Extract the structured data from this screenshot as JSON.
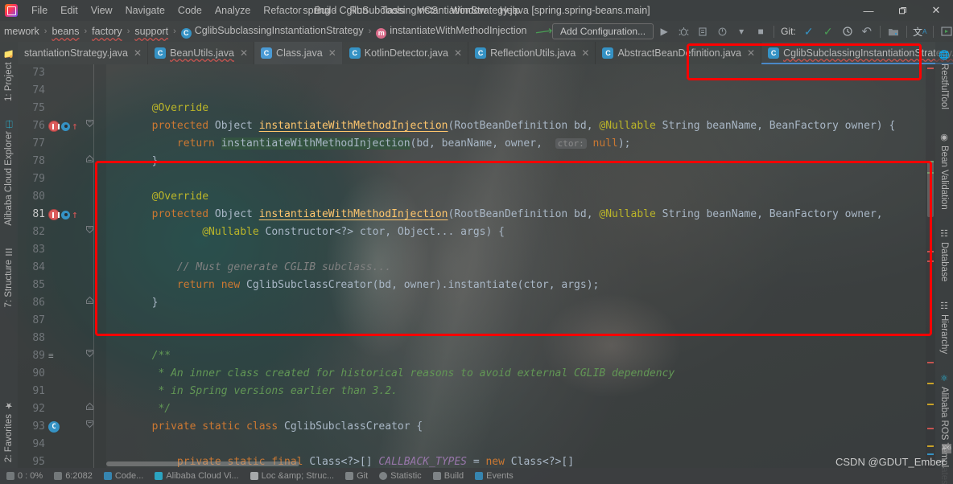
{
  "window": {
    "title": "spring - CglibSubclassingInstantiationStrategy.java [spring.spring-beans.main]",
    "minimize": "—",
    "maximize": "❐",
    "close": "✕"
  },
  "menubar": {
    "items": [
      "File",
      "Edit",
      "View",
      "Navigate",
      "Code",
      "Analyze",
      "Refactor",
      "Build",
      "Run",
      "Tools",
      "VCS",
      "Window",
      "Help"
    ]
  },
  "breadcrumbs": {
    "items": [
      {
        "label": "mework",
        "icon": "",
        "squiggle": false
      },
      {
        "label": "beans",
        "icon": "",
        "squiggle": true
      },
      {
        "label": "factory",
        "icon": "",
        "squiggle": true
      },
      {
        "label": "support",
        "icon": "",
        "squiggle": true
      },
      {
        "label": "CglibSubclassingInstantiationStrategy",
        "icon": "class-icon",
        "icon_letter": "C",
        "squiggle": true
      },
      {
        "label": "instantiateWithMethodInjection",
        "icon": "method-icon",
        "icon_letter": "m",
        "squiggle": true
      }
    ],
    "separator": "›"
  },
  "toolbar": {
    "run_configuration": "Add Configuration...",
    "run_icon": "▶",
    "debug_icon": "debug-icon",
    "coverage_icon": "coverage-icon",
    "profile_icon": "profile-icon",
    "dropdown_icon": "▾",
    "stop_icon": "■",
    "git_label": "Git:",
    "update_icon": "✓",
    "commit_icon": "✓",
    "history_icon": "◴",
    "rollback_icon": "↶",
    "folder_icon": "folder-icon",
    "translate_icon": "translate-icon",
    "preview_icon": "preview-icon",
    "search_icon": "⚲"
  },
  "left_tool_strip": {
    "tabs": [
      {
        "label": "1: Project",
        "icon": "folder-icon"
      },
      {
        "label": "Alibaba Cloud Explorer",
        "icon": "cloud-icon"
      },
      {
        "label": "7: Structure",
        "icon": "structure-icon"
      },
      {
        "label": "2: Favorites",
        "icon": "star-icon"
      }
    ]
  },
  "right_tool_strip": {
    "tabs": [
      {
        "label": "RestfulTool",
        "icon": "globe-icon"
      },
      {
        "label": "Bean Validation",
        "icon": "bean-icon"
      },
      {
        "label": "Database",
        "icon": "database-icon"
      },
      {
        "label": "Hierarchy",
        "icon": "hierarchy-icon"
      },
      {
        "label": "Alibaba ROS Templates",
        "icon": "ros-icon"
      }
    ]
  },
  "editor_tabs": {
    "close_glyph": "✕",
    "items": [
      {
        "label": "stantiationStrategy.java",
        "icon_letter": "C",
        "state": "normal",
        "squiggle": false,
        "truncated": true
      },
      {
        "label": "BeanUtils.java",
        "icon_letter": "C",
        "state": "normal",
        "squiggle": true
      },
      {
        "label": "Class.java",
        "icon_letter": "C",
        "state": "active",
        "squiggle": false
      },
      {
        "label": "KotlinDetector.java",
        "icon_letter": "C",
        "state": "normal",
        "squiggle": false
      },
      {
        "label": "ReflectionUtils.java",
        "icon_letter": "C",
        "state": "normal",
        "squiggle": false
      },
      {
        "label": "AbstractBeanDefinition.java",
        "icon_letter": "C",
        "state": "normal",
        "squiggle": false
      },
      {
        "label": "CglibSubclassingInstantiationStrategy.java",
        "icon_letter": "C",
        "state": "selected",
        "squiggle": true
      }
    ]
  },
  "code": {
    "first_line": 73,
    "lines": [
      {
        "num": 73,
        "html": ""
      },
      {
        "num": 74,
        "html": ""
      },
      {
        "num": 75,
        "html": "        <span class=\"ann\">@Override</span>"
      },
      {
        "num": 76,
        "html": "        <span class=\"kw\">protected</span> <span class=\"typ\">Object</span> <span class=\"mth usage\">instantiateWithMethodInjection</span><span class=\"pun\">(</span><span class=\"typ\">RootBeanDefinition</span> bd<span class=\"pun\">,</span> <span class=\"ann\">@Nullable</span> <span class=\"typ\">String</span> beanName<span class=\"pun\">,</span> <span class=\"typ\">BeanFactory</span> owner<span class=\"pun\">) {</span>",
        "gutter": {
          "breakpoint": true,
          "override": true,
          "fold": "collapse"
        },
        "current": false
      },
      {
        "num": 77,
        "html": "            <span class=\"kw\">return</span> <span class=\"hl\">instantiateWithMethodInjection</span><span class=\"pun\">(</span>bd<span class=\"pun\">,</span> beanName<span class=\"pun\">,</span> owner<span class=\"pun\">,</span>  <span class=\"hintbox\">ctor:</span> <span class=\"kw\">null</span><span class=\"pun\">);</span>"
      },
      {
        "num": 78,
        "html": "        <span class=\"pun\">}</span>",
        "gutter": {
          "fold": "end"
        }
      },
      {
        "num": 79,
        "html": ""
      },
      {
        "num": 80,
        "html": "        <span class=\"ann\">@Override</span>"
      },
      {
        "num": 81,
        "html": "        <span class=\"kw\">protected</span> <span class=\"typ\">Object</span> <span class=\"mth usage\">instantiateWithMethodInjection</span><span class=\"pun\">(</span><span class=\"typ\">RootBeanDefinition</span> bd<span class=\"pun\">,</span> <span class=\"ann\">@Nullable</span> <span class=\"typ\">String</span> beanName<span class=\"pun\">,</span> <span class=\"typ\">BeanFactory</span> owner<span class=\"pun\">,</span>",
        "gutter": {
          "breakpoint": true,
          "override": true
        },
        "current": true
      },
      {
        "num": 82,
        "html": "                <span class=\"ann\">@Nullable</span> <span class=\"typ\">Constructor&lt;?&gt;</span> ctor<span class=\"pun\">,</span> <span class=\"typ\">Object</span>... args<span class=\"pun\">) {</span>",
        "gutter": {
          "fold": "collapse"
        }
      },
      {
        "num": 83,
        "html": ""
      },
      {
        "num": 84,
        "html": "            <span class=\"lcmt\">// Must generate CGLIB subclass...</span>"
      },
      {
        "num": 85,
        "html": "            <span class=\"kw\">return</span> <span class=\"kw\">new</span> <span class=\"typ\">CglibSubclassCreator</span><span class=\"pun\">(</span>bd<span class=\"pun\">,</span> owner<span class=\"pun\">).</span>instantiate<span class=\"pun\">(</span>ctor<span class=\"pun\">,</span> args<span class=\"pun\">);</span>"
      },
      {
        "num": 86,
        "html": "        <span class=\"pun\">}</span>",
        "gutter": {
          "fold": "end"
        }
      },
      {
        "num": 87,
        "html": ""
      },
      {
        "num": 88,
        "html": ""
      },
      {
        "num": 89,
        "html": "        <span class=\"cmt\">/**</span>",
        "gutter": {
          "doc": true,
          "fold": "collapse"
        }
      },
      {
        "num": 90,
        "html": "         <span class=\"cmt\">* An inner class created for historical reasons to avoid external CGLIB dependency</span>"
      },
      {
        "num": 91,
        "html": "         <span class=\"cmt\">* in Spring versions earlier than 3.2.</span>"
      },
      {
        "num": 92,
        "html": "         <span class=\"cmt\">*/</span>",
        "gutter": {
          "fold": "end"
        }
      },
      {
        "num": 93,
        "html": "        <span class=\"kw\">private</span> <span class=\"kw\">static</span> <span class=\"kw\">class</span> <span class=\"typ\">CglibSubclassCreator</span> <span class=\"pun\">{</span>",
        "gutter": {
          "classicon": true,
          "fold": "collapse"
        }
      },
      {
        "num": 94,
        "html": ""
      },
      {
        "num": 95,
        "html": "            <span class=\"kw\">private</span> <span class=\"kw\">static</span> <span class=\"kw\">final</span> <span class=\"typ\">Class&lt;?&gt;[]</span> <span class=\"fld\">CALLBACK_TYPES</span> <span class=\"pun\">=</span> <span class=\"kw\">new</span> <span class=\"typ\">Class&lt;?&gt;[]</span>"
      }
    ]
  },
  "annotations": {
    "code_box_color": "#ff0000",
    "tab_box_color": "#ff0000"
  },
  "statusbar": {
    "items": [
      "0 : 0%",
      "6:2082",
      "Code...",
      "Alibaba Cloud Vi...",
      "Loc &amp; Struc...",
      "Git",
      "Statistic",
      "Build",
      "Events"
    ]
  },
  "watermark": {
    "text": "CSDN @GDUT_Ember"
  }
}
